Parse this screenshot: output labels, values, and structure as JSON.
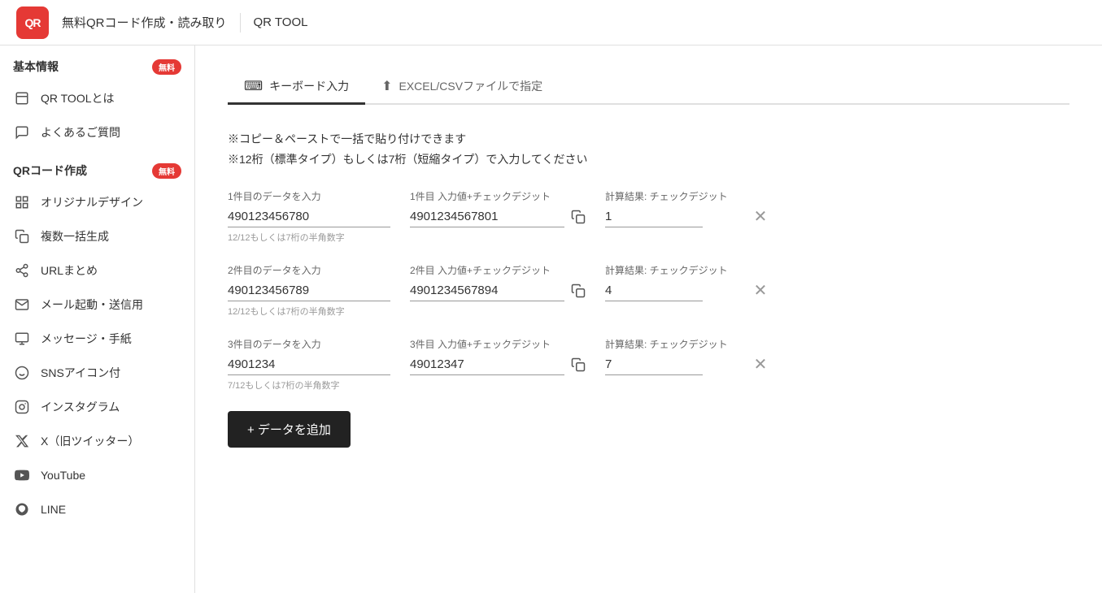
{
  "header": {
    "logo_text": "QR",
    "title": "無料QRコード作成・読み取り",
    "subtitle": "QR TOOL"
  },
  "sidebar": {
    "section1": {
      "title": "基本情報",
      "badge": "無料",
      "items": [
        {
          "id": "qrtool",
          "label": "QR TOOLとは",
          "icon": "book"
        },
        {
          "id": "faq",
          "label": "よくあるご質問",
          "icon": "chat"
        }
      ]
    },
    "section2": {
      "title": "QRコード作成",
      "badge": "無料",
      "items": [
        {
          "id": "original",
          "label": "オリジナルデザイン",
          "icon": "grid"
        },
        {
          "id": "bulk",
          "label": "複数一括生成",
          "icon": "copy"
        },
        {
          "id": "url",
          "label": "URLまとめ",
          "icon": "share"
        },
        {
          "id": "mail",
          "label": "メール起動・送信用",
          "icon": "mail"
        },
        {
          "id": "message",
          "label": "メッセージ・手紙",
          "icon": "msg"
        },
        {
          "id": "sns",
          "label": "SNSアイコン付",
          "icon": "smile"
        },
        {
          "id": "instagram",
          "label": "インスタグラム",
          "icon": "instagram"
        },
        {
          "id": "twitter",
          "label": "X（旧ツイッター）",
          "icon": "x"
        },
        {
          "id": "youtube",
          "label": "YouTube",
          "icon": "youtube"
        },
        {
          "id": "line",
          "label": "LINE",
          "icon": "line"
        }
      ]
    }
  },
  "tabs": [
    {
      "id": "keyboard",
      "label": "キーボード入力",
      "icon": "⌨",
      "active": true
    },
    {
      "id": "excel",
      "label": "EXCEL/CSVファイルで指定",
      "icon": "⬆",
      "active": false
    }
  ],
  "notice": {
    "line1": "※コピー＆ペーストで一括で貼り付けできます",
    "line2": "※12桁（標準タイプ）もしくは7桁（短縮タイプ）で入力してください"
  },
  "rows": [
    {
      "input_label": "1件目のデータを入力",
      "input_value": "490123456780",
      "input_hint": "12/12もしくは7桁の半角数字",
      "result_label": "1件目 入力値+チェックデジット",
      "result_value": "4901234567801",
      "check_label": "計算結果: チェックデジット",
      "check_value": "1"
    },
    {
      "input_label": "2件目のデータを入力",
      "input_value": "490123456789",
      "input_hint": "12/12もしくは7桁の半角数字",
      "result_label": "2件目 入力値+チェックデジット",
      "result_value": "4901234567894",
      "check_label": "計算結果: チェックデジット",
      "check_value": "4"
    },
    {
      "input_label": "3件目のデータを入力",
      "input_value": "4901234",
      "input_hint": "7/12もしくは7桁の半角数字",
      "result_label": "3件目 入力値+チェックデジット",
      "result_value": "49012347",
      "check_label": "計算結果: チェックデジット",
      "check_value": "7"
    }
  ],
  "add_button_label": "+ データを追加"
}
